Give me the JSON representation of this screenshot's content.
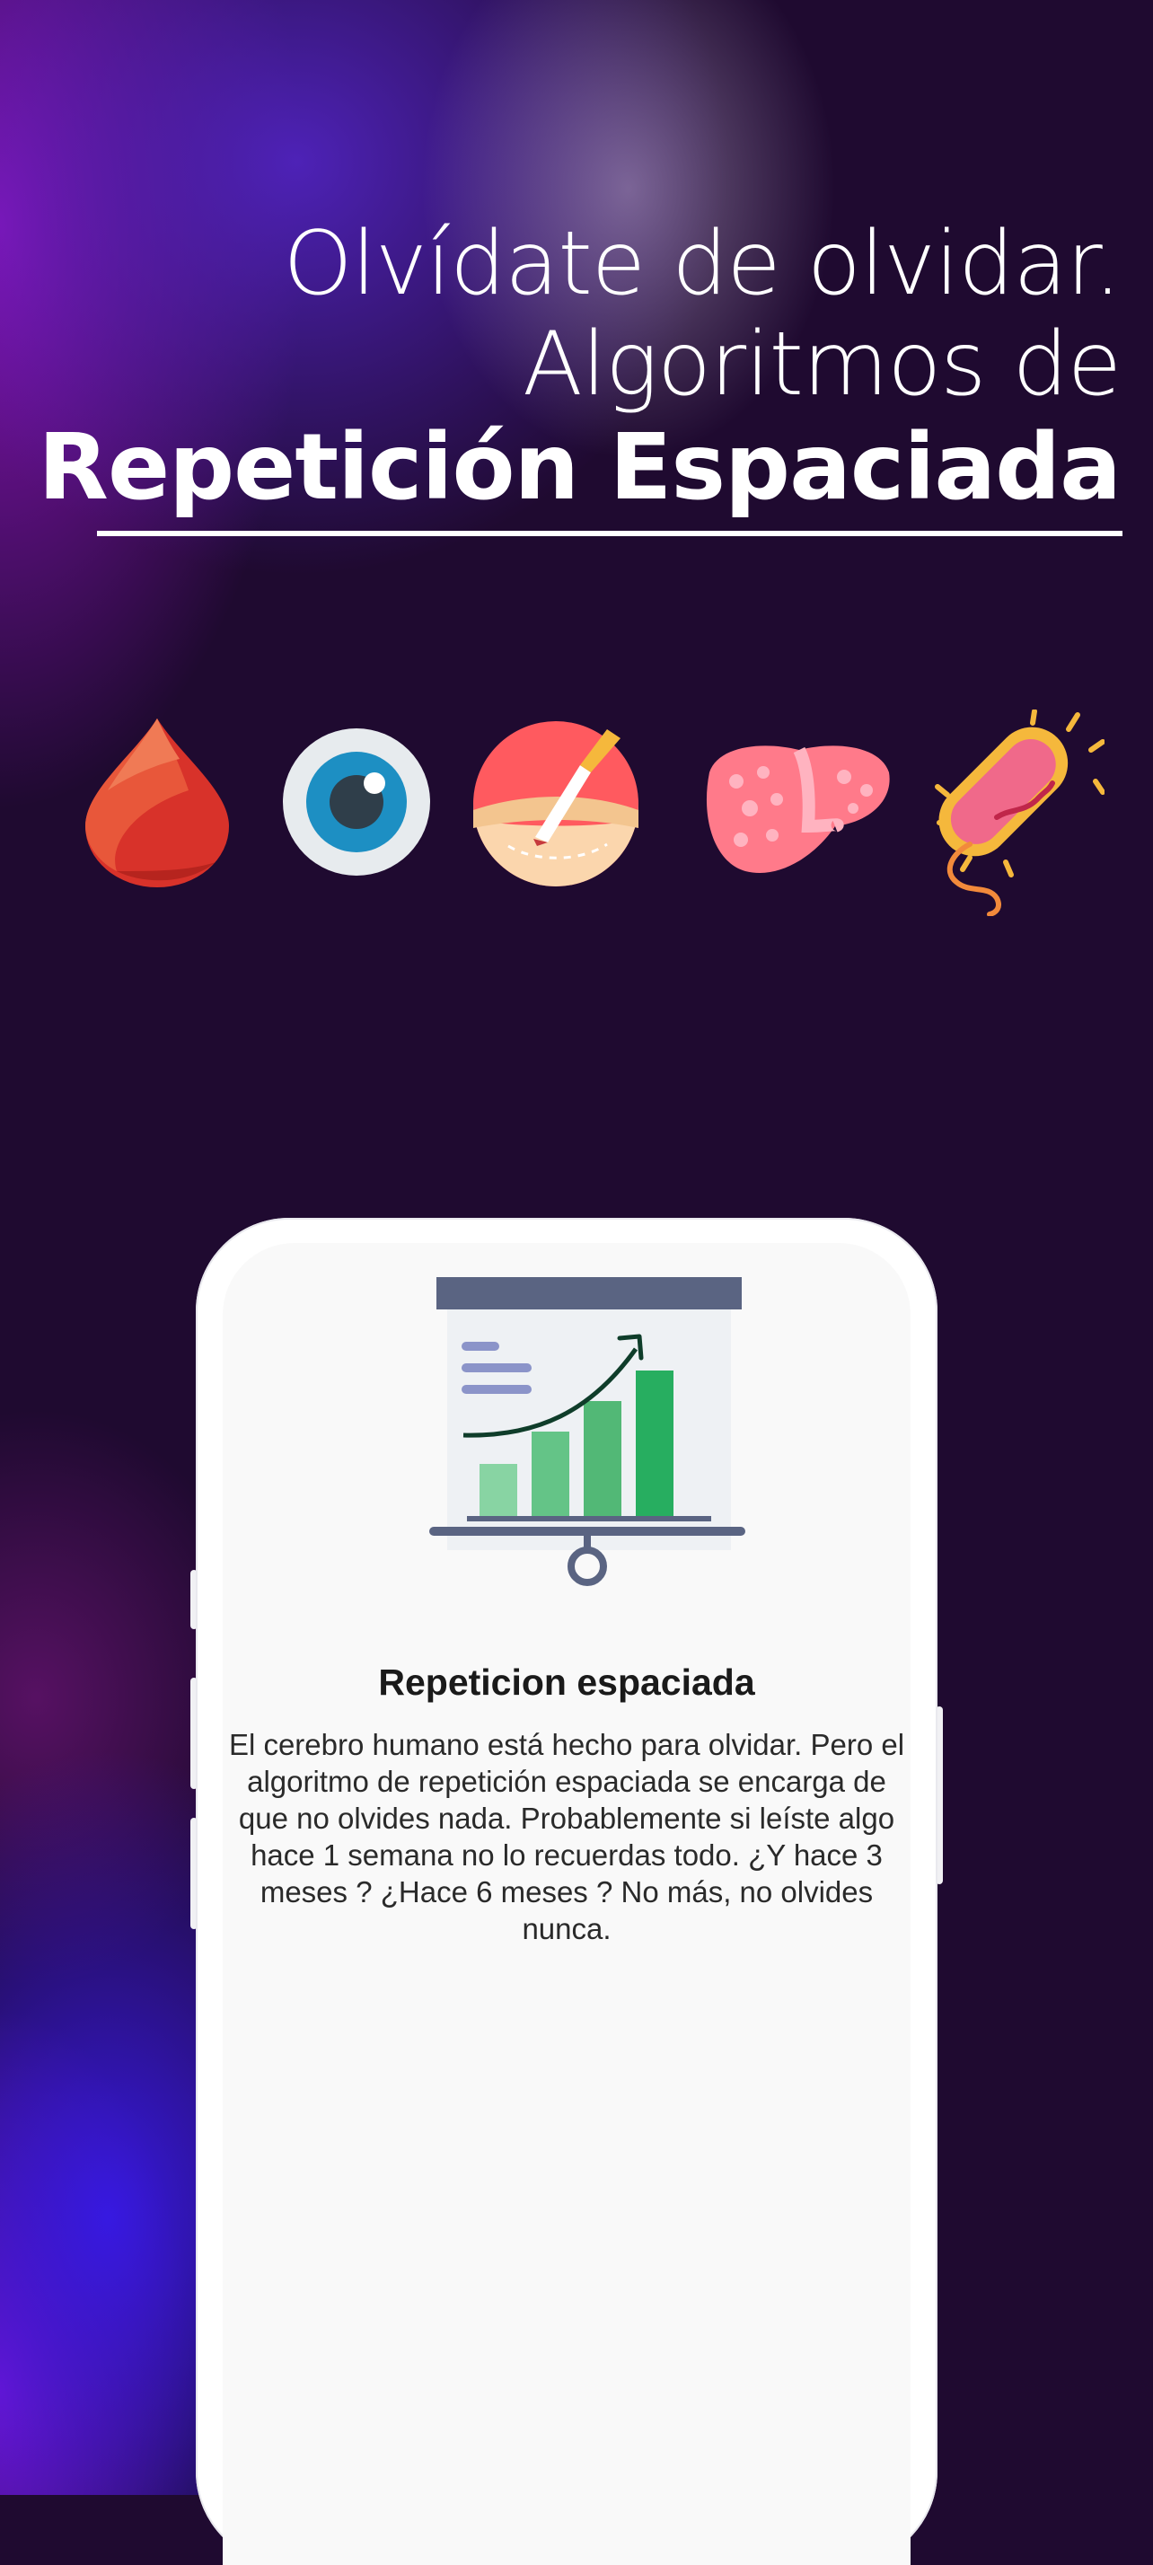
{
  "headline": {
    "line1": "Olvídate de olvidar.",
    "line2": "Algoritmos de",
    "line3": "Repetición Espaciada"
  },
  "icons": [
    "blood-drop-icon",
    "eye-icon",
    "scalpel-surgery-icon",
    "liver-icon",
    "bacteria-icon"
  ],
  "card": {
    "title": "Repeticion espaciada",
    "body": "El cerebro humano está hecho para olvidar. Pero el algoritmo de repetición espaciada se encarga de que no olvides nada. Probablemente si leíste algo hace 1 semana no lo recuerdas todo. ¿Y hace 3 meses ? ¿Hace 6 meses ? No más, no olvides nunca.",
    "illustration": "growth-chart-presentation-icon"
  },
  "colors": {
    "background": "#1f0a30",
    "text": "#ffffff",
    "chart_bar": "#27ae60"
  }
}
